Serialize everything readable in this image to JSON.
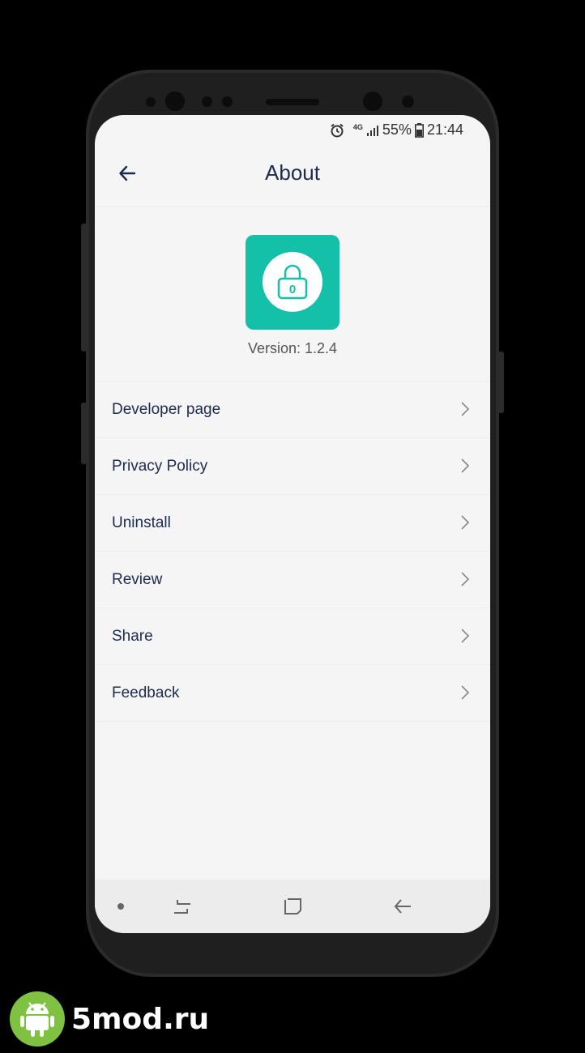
{
  "statusbar": {
    "network": "4G",
    "battery": "55%",
    "time": "21:44"
  },
  "appbar": {
    "title": "About",
    "back_icon": "arrow-left-icon"
  },
  "about": {
    "app_icon": "lock-icon",
    "lock_digit": "0",
    "version": "Version: 1.2.4"
  },
  "menu": {
    "items": [
      {
        "label": "Developer page"
      },
      {
        "label": "Privacy Policy"
      },
      {
        "label": "Uninstall"
      },
      {
        "label": "Review"
      },
      {
        "label": "Share"
      },
      {
        "label": "Feedback"
      }
    ]
  },
  "navbar": {
    "recents_icon": "recents-icon",
    "home_icon": "home-icon",
    "back_icon": "back-icon"
  },
  "watermark": {
    "text": "5mod.ru"
  },
  "colors": {
    "accent": "#14c1a8",
    "title_text": "#1d2b4e"
  }
}
